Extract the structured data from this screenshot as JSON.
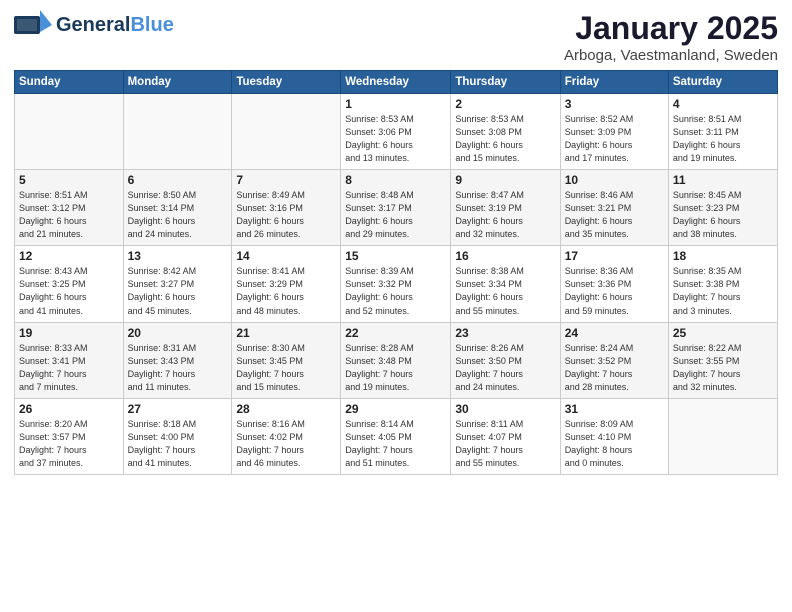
{
  "header": {
    "logo_general": "General",
    "logo_blue": "Blue",
    "title": "January 2025",
    "subtitle": "Arboga, Vaestmanland, Sweden"
  },
  "weekdays": [
    "Sunday",
    "Monday",
    "Tuesday",
    "Wednesday",
    "Thursday",
    "Friday",
    "Saturday"
  ],
  "weeks": [
    [
      {
        "day": "",
        "info": ""
      },
      {
        "day": "",
        "info": ""
      },
      {
        "day": "",
        "info": ""
      },
      {
        "day": "1",
        "info": "Sunrise: 8:53 AM\nSunset: 3:06 PM\nDaylight: 6 hours\nand 13 minutes."
      },
      {
        "day": "2",
        "info": "Sunrise: 8:53 AM\nSunset: 3:08 PM\nDaylight: 6 hours\nand 15 minutes."
      },
      {
        "day": "3",
        "info": "Sunrise: 8:52 AM\nSunset: 3:09 PM\nDaylight: 6 hours\nand 17 minutes."
      },
      {
        "day": "4",
        "info": "Sunrise: 8:51 AM\nSunset: 3:11 PM\nDaylight: 6 hours\nand 19 minutes."
      }
    ],
    [
      {
        "day": "5",
        "info": "Sunrise: 8:51 AM\nSunset: 3:12 PM\nDaylight: 6 hours\nand 21 minutes."
      },
      {
        "day": "6",
        "info": "Sunrise: 8:50 AM\nSunset: 3:14 PM\nDaylight: 6 hours\nand 24 minutes."
      },
      {
        "day": "7",
        "info": "Sunrise: 8:49 AM\nSunset: 3:16 PM\nDaylight: 6 hours\nand 26 minutes."
      },
      {
        "day": "8",
        "info": "Sunrise: 8:48 AM\nSunset: 3:17 PM\nDaylight: 6 hours\nand 29 minutes."
      },
      {
        "day": "9",
        "info": "Sunrise: 8:47 AM\nSunset: 3:19 PM\nDaylight: 6 hours\nand 32 minutes."
      },
      {
        "day": "10",
        "info": "Sunrise: 8:46 AM\nSunset: 3:21 PM\nDaylight: 6 hours\nand 35 minutes."
      },
      {
        "day": "11",
        "info": "Sunrise: 8:45 AM\nSunset: 3:23 PM\nDaylight: 6 hours\nand 38 minutes."
      }
    ],
    [
      {
        "day": "12",
        "info": "Sunrise: 8:43 AM\nSunset: 3:25 PM\nDaylight: 6 hours\nand 41 minutes."
      },
      {
        "day": "13",
        "info": "Sunrise: 8:42 AM\nSunset: 3:27 PM\nDaylight: 6 hours\nand 45 minutes."
      },
      {
        "day": "14",
        "info": "Sunrise: 8:41 AM\nSunset: 3:29 PM\nDaylight: 6 hours\nand 48 minutes."
      },
      {
        "day": "15",
        "info": "Sunrise: 8:39 AM\nSunset: 3:32 PM\nDaylight: 6 hours\nand 52 minutes."
      },
      {
        "day": "16",
        "info": "Sunrise: 8:38 AM\nSunset: 3:34 PM\nDaylight: 6 hours\nand 55 minutes."
      },
      {
        "day": "17",
        "info": "Sunrise: 8:36 AM\nSunset: 3:36 PM\nDaylight: 6 hours\nand 59 minutes."
      },
      {
        "day": "18",
        "info": "Sunrise: 8:35 AM\nSunset: 3:38 PM\nDaylight: 7 hours\nand 3 minutes."
      }
    ],
    [
      {
        "day": "19",
        "info": "Sunrise: 8:33 AM\nSunset: 3:41 PM\nDaylight: 7 hours\nand 7 minutes."
      },
      {
        "day": "20",
        "info": "Sunrise: 8:31 AM\nSunset: 3:43 PM\nDaylight: 7 hours\nand 11 minutes."
      },
      {
        "day": "21",
        "info": "Sunrise: 8:30 AM\nSunset: 3:45 PM\nDaylight: 7 hours\nand 15 minutes."
      },
      {
        "day": "22",
        "info": "Sunrise: 8:28 AM\nSunset: 3:48 PM\nDaylight: 7 hours\nand 19 minutes."
      },
      {
        "day": "23",
        "info": "Sunrise: 8:26 AM\nSunset: 3:50 PM\nDaylight: 7 hours\nand 24 minutes."
      },
      {
        "day": "24",
        "info": "Sunrise: 8:24 AM\nSunset: 3:52 PM\nDaylight: 7 hours\nand 28 minutes."
      },
      {
        "day": "25",
        "info": "Sunrise: 8:22 AM\nSunset: 3:55 PM\nDaylight: 7 hours\nand 32 minutes."
      }
    ],
    [
      {
        "day": "26",
        "info": "Sunrise: 8:20 AM\nSunset: 3:57 PM\nDaylight: 7 hours\nand 37 minutes."
      },
      {
        "day": "27",
        "info": "Sunrise: 8:18 AM\nSunset: 4:00 PM\nDaylight: 7 hours\nand 41 minutes."
      },
      {
        "day": "28",
        "info": "Sunrise: 8:16 AM\nSunset: 4:02 PM\nDaylight: 7 hours\nand 46 minutes."
      },
      {
        "day": "29",
        "info": "Sunrise: 8:14 AM\nSunset: 4:05 PM\nDaylight: 7 hours\nand 51 minutes."
      },
      {
        "day": "30",
        "info": "Sunrise: 8:11 AM\nSunset: 4:07 PM\nDaylight: 7 hours\nand 55 minutes."
      },
      {
        "day": "31",
        "info": "Sunrise: 8:09 AM\nSunset: 4:10 PM\nDaylight: 8 hours\nand 0 minutes."
      },
      {
        "day": "",
        "info": ""
      }
    ]
  ]
}
